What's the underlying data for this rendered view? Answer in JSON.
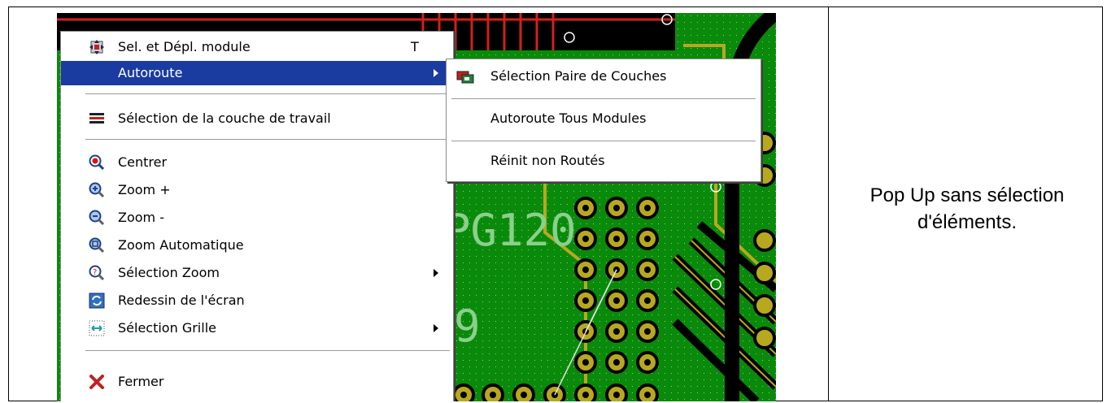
{
  "caption": "Pop Up sans sélection d'éléments.",
  "pcb_labels": {
    "ref": "PG120",
    "digit": "9"
  },
  "menu": {
    "items": [
      {
        "label": "Sel. et Dépl. module",
        "shortcut": "T",
        "icon": "move-module-icon"
      },
      {
        "label": "Autoroute",
        "icon": "",
        "submenu": true,
        "highlighted": true
      },
      {
        "label": "Sélection de la couche de travail",
        "icon": "layers-icon"
      },
      {
        "label": "Centrer",
        "icon": "center-icon"
      },
      {
        "label": "Zoom +",
        "icon": "zoom-in-icon"
      },
      {
        "label": "Zoom -",
        "icon": "zoom-out-icon"
      },
      {
        "label": "Zoom Automatique",
        "icon": "zoom-auto-icon"
      },
      {
        "label": "Sélection Zoom",
        "icon": "zoom-select-icon",
        "submenu": true
      },
      {
        "label": "Redessin de l'écran",
        "icon": "redraw-icon"
      },
      {
        "label": "Sélection Grille",
        "icon": "grid-icon",
        "submenu": true
      },
      {
        "label": "Fermer",
        "icon": "close-icon"
      }
    ]
  },
  "submenu": {
    "items": [
      {
        "label": "Sélection Paire de Couches",
        "icon": "layer-pair-icon"
      },
      {
        "label": "Autoroute Tous Modules"
      },
      {
        "label": "Réinit non Routés"
      }
    ]
  },
  "colors": {
    "highlight": "#1a3ca0",
    "pcb_green": "#0a8a0a",
    "track_yellow": "#b8a820",
    "pad_black": "#000000"
  }
}
